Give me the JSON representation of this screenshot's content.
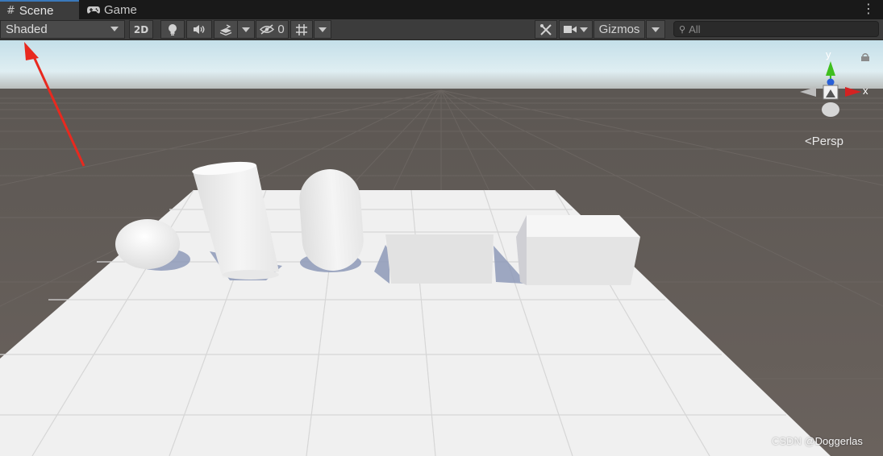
{
  "tabs": {
    "scene": {
      "label": "Scene",
      "icon": "grid-icon",
      "active": true
    },
    "game": {
      "label": "Game",
      "icon": "gamepad-icon"
    },
    "more_icon": "kebab-menu-icon"
  },
  "toolbar": {
    "shading_mode": "Shaded",
    "mode_2d_label": "2D",
    "hidden_objects_count": "0",
    "gizmos_label": "Gizmos",
    "search_placeholder": "All"
  },
  "viewport": {
    "projection_label": "Persp",
    "axis_labels": {
      "x": "x",
      "y": "y"
    },
    "axis_colors": {
      "x": "#d42222",
      "y": "#3fbf1f",
      "z": "#2860d8"
    },
    "watermark": "CSDN @Doggerlas",
    "annotation_arrow_color": "#e8291f",
    "objects": [
      "sphere",
      "cylinder",
      "capsule",
      "cube",
      "cube"
    ]
  }
}
